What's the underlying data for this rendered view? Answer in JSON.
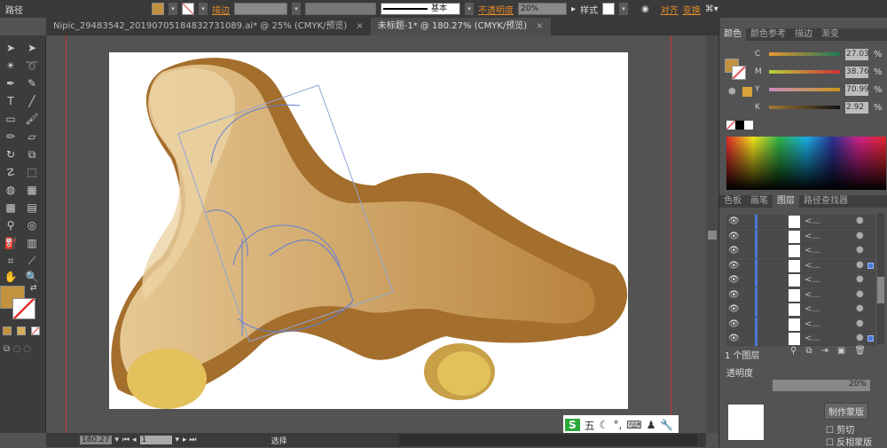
{
  "control_bar": {
    "object_type": "路径",
    "stroke_label": "描边",
    "stroke_style": "基本",
    "opacity_label": "不透明度",
    "opacity_value": "20%",
    "style_label": "样式",
    "align_label": "对齐",
    "transform_label": "变换",
    "fill_color": "#c3923f"
  },
  "tabs": [
    {
      "label": "Nipic_29483542_20190705184832731089.ai* @ 25% (CMYK/预览)",
      "close": "×"
    },
    {
      "label": "未标题-1* @ 180.27% (CMYK/预览)",
      "close": "×",
      "active": true
    }
  ],
  "color_panel": {
    "tabs": [
      "颜色",
      "颜色参考",
      "描边",
      "渐变"
    ],
    "channels": [
      {
        "label": "C",
        "value": "27.03",
        "fraction": 0.27
      },
      {
        "label": "M",
        "value": "38.76",
        "fraction": 0.39
      },
      {
        "label": "Y",
        "value": "70.99",
        "fraction": 0.71
      },
      {
        "label": "K",
        "value": "2.92",
        "fraction": 0.03
      }
    ],
    "percent": "%"
  },
  "layers_panel": {
    "tabs": [
      "色板",
      "画笔",
      "图层",
      "路径查找器"
    ],
    "row_label": "<...",
    "row_count": 9,
    "footer": "1 个图层"
  },
  "transparency_panel": {
    "title": "透明度",
    "opacity": "20%",
    "make_mask": "制作蒙版",
    "clip": "剪切",
    "invert_mask": "反相蒙版"
  },
  "status_bar": {
    "zoom": "180.27",
    "page": "1",
    "tool": "选择"
  },
  "ime": {
    "mode": "五"
  }
}
